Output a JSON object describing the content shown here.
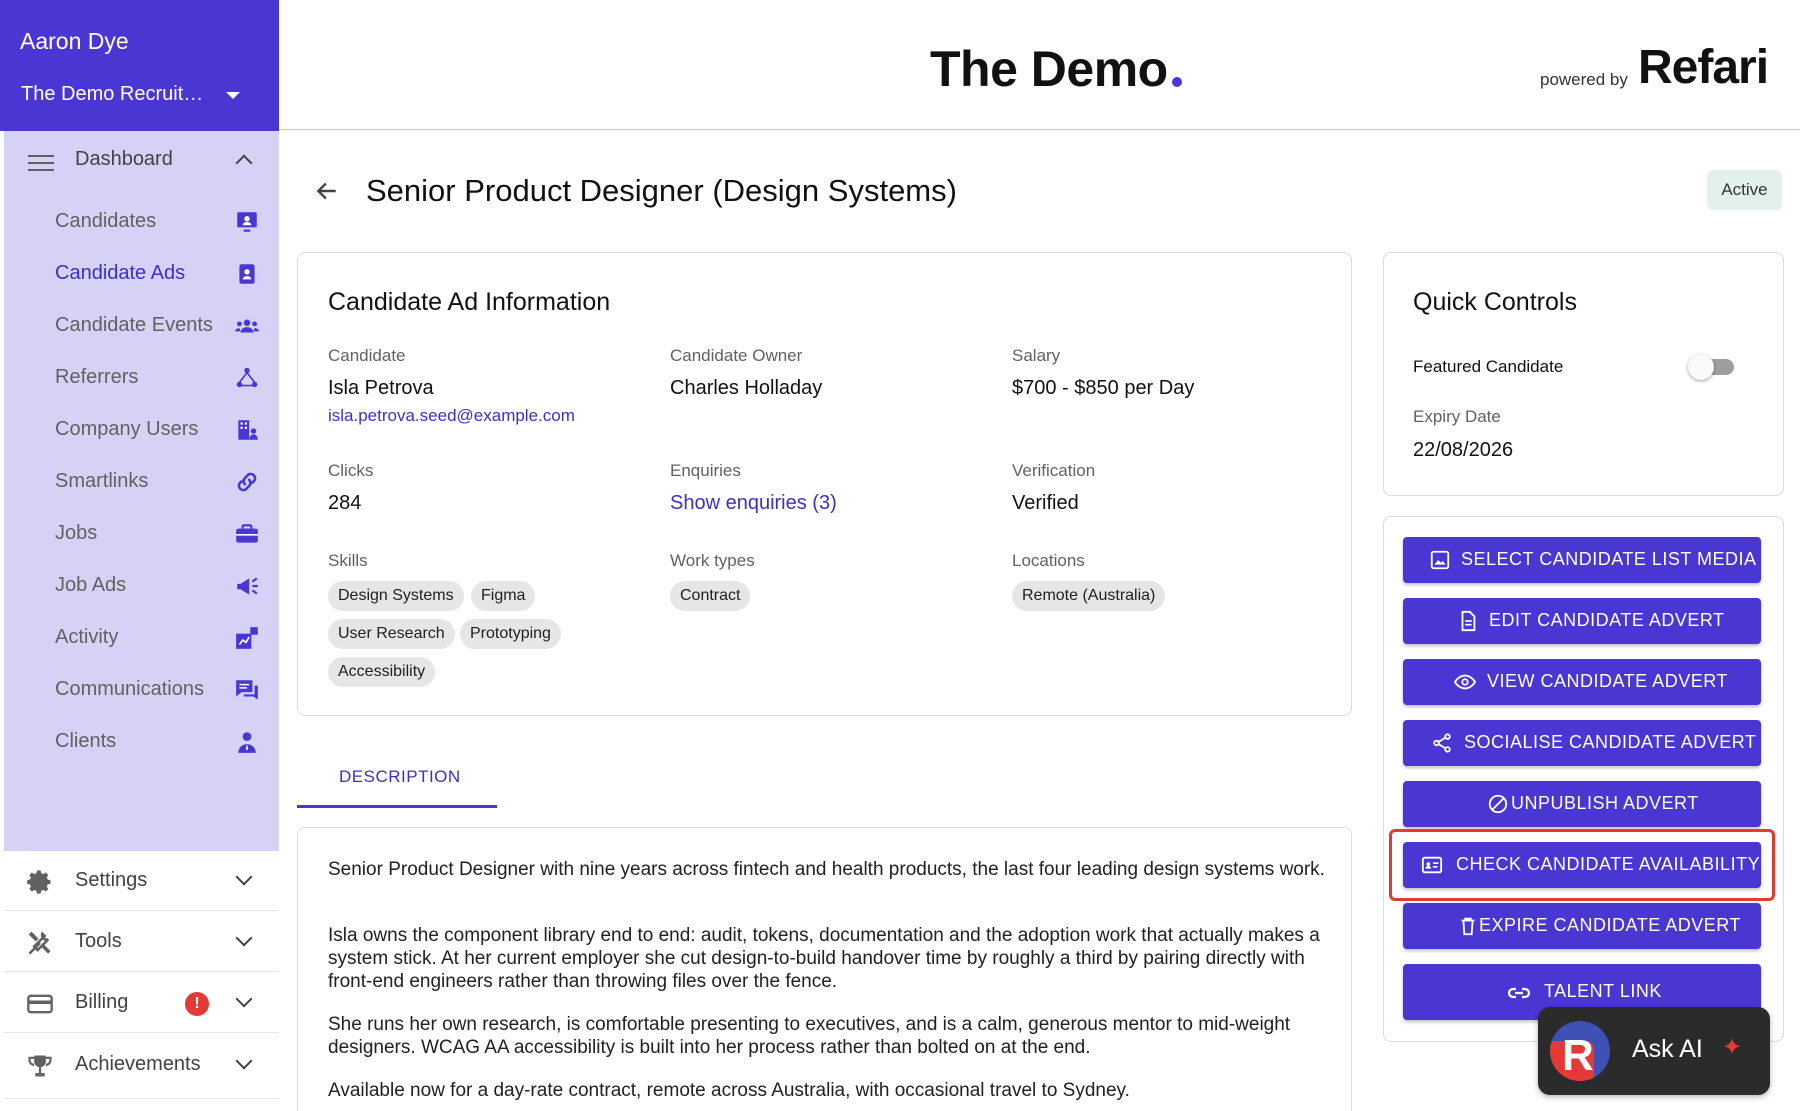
{
  "sidebar": {
    "user_name": "Aaron Dye",
    "company": "The Demo Recruitment",
    "dashboard_label": "Dashboard",
    "items": [
      {
        "label": "Candidates",
        "icon": "candidates-icon"
      },
      {
        "label": "Candidate Ads",
        "icon": "candidate-ads-icon"
      },
      {
        "label": "Candidate Events",
        "icon": "candidate-events-icon"
      },
      {
        "label": "Referrers",
        "icon": "referrers-icon"
      },
      {
        "label": "Company Users",
        "icon": "company-users-icon"
      },
      {
        "label": "Smartlinks",
        "icon": "link-icon"
      },
      {
        "label": "Jobs",
        "icon": "briefcase-icon"
      },
      {
        "label": "Job Ads",
        "icon": "megaphone-icon"
      },
      {
        "label": "Activity",
        "icon": "activity-icon"
      },
      {
        "label": "Communications",
        "icon": "chat-icon"
      },
      {
        "label": "Clients",
        "icon": "client-icon"
      }
    ],
    "settings_label": "Settings",
    "tools_label": "Tools",
    "billing_label": "Billing",
    "billing_alert": "!",
    "achievements_label": "Achievements",
    "active_color": "#3f2fc9"
  },
  "header": {
    "brand": "The Demo",
    "powered_by": "powered by",
    "refari": "Refari"
  },
  "page": {
    "title": "Senior Product Designer (Design Systems)",
    "status": "Active"
  },
  "info": {
    "title": "Candidate Ad Information",
    "candidate_label": "Candidate",
    "candidate_name": "Isla Petrova",
    "candidate_email": "isla.petrova.seed@example.com",
    "owner_label": "Candidate Owner",
    "owner_name": "Charles Holladay",
    "salary_label": "Salary",
    "salary_value": "$700 - $850 per Day",
    "clicks_label": "Clicks",
    "clicks_value": "284",
    "enquiries_label": "Enquiries",
    "enquiries_value": "Show enquiries (3)",
    "verification_label": "Verification",
    "verification_value": "Verified",
    "skills_label": "Skills",
    "skills": [
      "Design Systems",
      "Figma",
      "User Research",
      "Prototyping",
      "Accessibility"
    ],
    "worktypes_label": "Work types",
    "worktypes": [
      "Contract"
    ],
    "locations_label": "Locations",
    "locations": [
      "Remote (Australia)"
    ]
  },
  "tabs": {
    "description": "DESCRIPTION"
  },
  "description": {
    "p1": "Senior Product Designer with nine years across fintech and health products, the last four leading design systems work.",
    "p2": "Isla owns the component library end to end: audit, tokens, documentation and the adoption work that actually makes a system stick. At her current employer she cut design-to-build handover time by roughly a third by pairing directly with front-end engineers rather than throwing files over the fence.",
    "p3": "She runs her own research, is comfortable presenting to executives, and is a calm, generous mentor to mid-weight designers. WCAG AA accessibility is built into her process rather than bolted on at the end.",
    "p4": "Available now for a day-rate contract, remote across Australia, with occasional travel to Sydney."
  },
  "quick_controls": {
    "title": "Quick Controls",
    "featured_label": "Featured Candidate",
    "featured_on": false,
    "expiry_label": "Expiry Date",
    "expiry_value": "22/08/2026"
  },
  "actions": {
    "select_media": "SELECT CANDIDATE LIST MEDIA",
    "edit": "EDIT CANDIDATE ADVERT",
    "view": "VIEW CANDIDATE ADVERT",
    "socialise": "SOCIALISE CANDIDATE ADVERT",
    "unpublish": "UNPUBLISH ADVERT",
    "check_availability": "CHECK CANDIDATE AVAILABILITY",
    "expire": "EXPIRE CANDIDATE ADVERT",
    "talent_link": "TALENT LINK",
    "button_color": "#4a36d3"
  },
  "ask_ai": {
    "logo": "R",
    "label": "Ask AI"
  }
}
